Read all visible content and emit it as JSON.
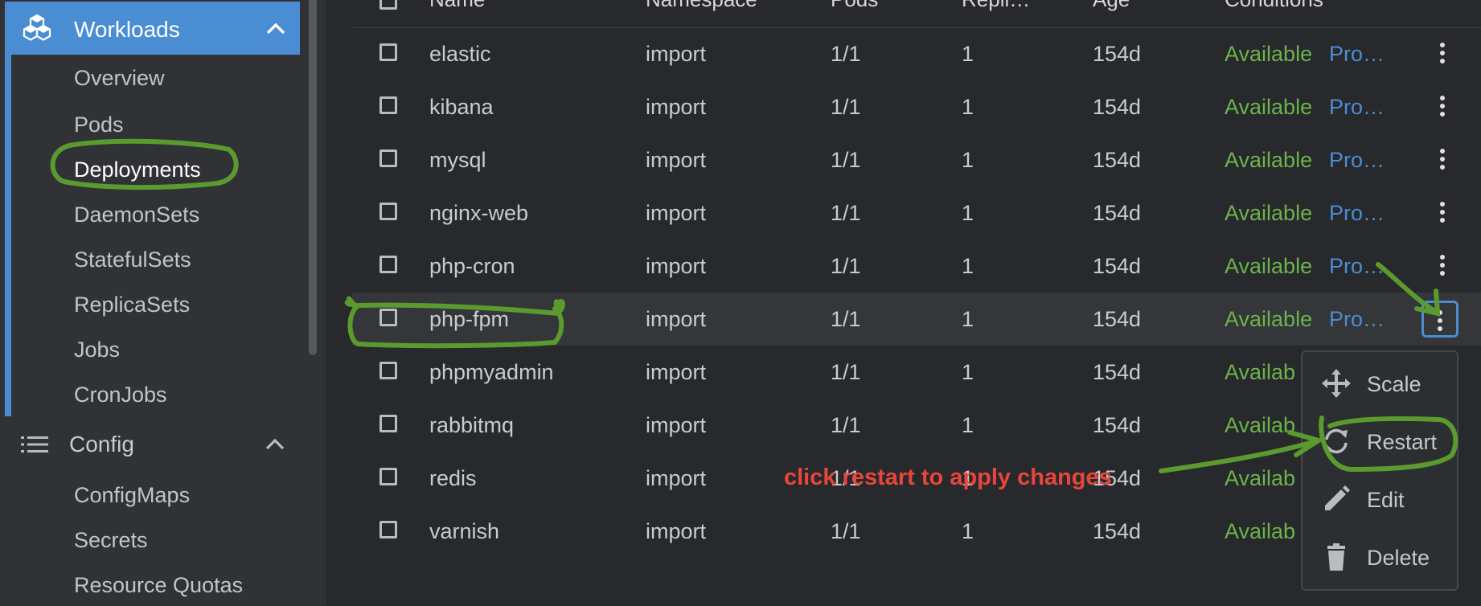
{
  "sidebar": {
    "workloads": {
      "label": "Workloads",
      "items": [
        "Overview",
        "Pods",
        "Deployments",
        "DaemonSets",
        "StatefulSets",
        "ReplicaSets",
        "Jobs",
        "CronJobs"
      ],
      "active": "Deployments"
    },
    "config": {
      "label": "Config",
      "items": [
        "ConfigMaps",
        "Secrets",
        "Resource Quotas"
      ]
    }
  },
  "table": {
    "headers": [
      "Name",
      "Namespace",
      "Pods",
      "Repli…",
      "Age",
      "Conditions"
    ],
    "rows": [
      {
        "name": "elastic",
        "namespace": "import",
        "pods": "1/1",
        "replicas": "1",
        "age": "154d",
        "cond1": "Available",
        "cond2": "Pro…"
      },
      {
        "name": "kibana",
        "namespace": "import",
        "pods": "1/1",
        "replicas": "1",
        "age": "154d",
        "cond1": "Available",
        "cond2": "Pro…"
      },
      {
        "name": "mysql",
        "namespace": "import",
        "pods": "1/1",
        "replicas": "1",
        "age": "154d",
        "cond1": "Available",
        "cond2": "Pro…"
      },
      {
        "name": "nginx-web",
        "namespace": "import",
        "pods": "1/1",
        "replicas": "1",
        "age": "154d",
        "cond1": "Available",
        "cond2": "Pro…"
      },
      {
        "name": "php-cron",
        "namespace": "import",
        "pods": "1/1",
        "replicas": "1",
        "age": "154d",
        "cond1": "Available",
        "cond2": "Pro…"
      },
      {
        "name": "php-fpm",
        "namespace": "import",
        "pods": "1/1",
        "replicas": "1",
        "age": "154d",
        "cond1": "Available",
        "cond2": "Pro…"
      },
      {
        "name": "phpmyadmin",
        "namespace": "import",
        "pods": "1/1",
        "replicas": "1",
        "age": "154d",
        "cond1": "Availab",
        "cond2": ""
      },
      {
        "name": "rabbitmq",
        "namespace": "import",
        "pods": "1/1",
        "replicas": "1",
        "age": "154d",
        "cond1": "Availab",
        "cond2": ""
      },
      {
        "name": "redis",
        "namespace": "import",
        "pods": "1/1",
        "replicas": "1",
        "age": "154d",
        "cond1": "Availab",
        "cond2": ""
      },
      {
        "name": "varnish",
        "namespace": "import",
        "pods": "1/1",
        "replicas": "1",
        "age": "154d",
        "cond1": "Availab",
        "cond2": ""
      }
    ],
    "highlighted_row": "php-fpm"
  },
  "context_menu": {
    "items": [
      {
        "label": "Scale",
        "icon": "scale-icon"
      },
      {
        "label": "Restart",
        "icon": "restart-icon"
      },
      {
        "label": "Edit",
        "icon": "pencil-icon"
      },
      {
        "label": "Delete",
        "icon": "trash-icon"
      }
    ]
  },
  "annotation": {
    "text": "click restart to apply changes"
  },
  "colors": {
    "accent": "#4a8dd3",
    "available": "#6cb34a",
    "annotation_green": "#5b9a2f",
    "annotation_red": "#e8463a"
  }
}
